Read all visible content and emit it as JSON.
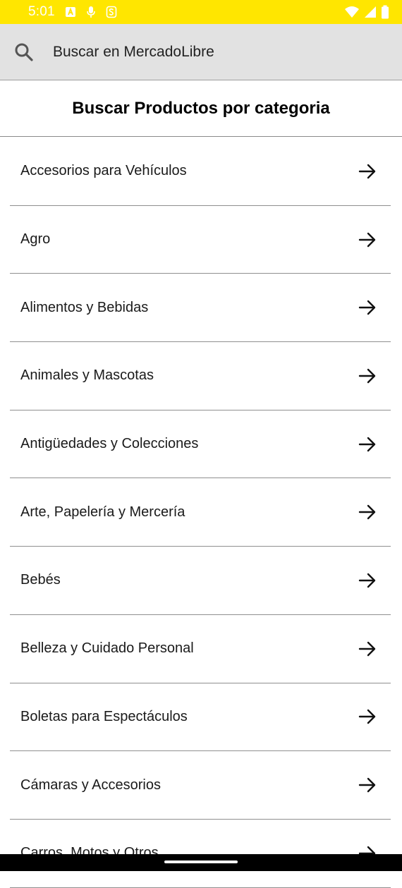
{
  "status_bar": {
    "time": "5:01",
    "background": "#ffe600",
    "left_icons": [
      "a-box-icon",
      "mic-icon",
      "s-icon"
    ],
    "right_icons": [
      "wifi-icon",
      "signal-icon",
      "battery-icon"
    ]
  },
  "search": {
    "placeholder": "Buscar en MercadoLibre"
  },
  "header": {
    "title": "Buscar Productos por categoria"
  },
  "categories": [
    {
      "label": "Accesorios para Vehículos"
    },
    {
      "label": "Agro"
    },
    {
      "label": "Alimentos y Bebidas"
    },
    {
      "label": "Animales y Mascotas"
    },
    {
      "label": "Antigüedades y Colecciones"
    },
    {
      "label": "Arte, Papelería y Mercería"
    },
    {
      "label": "Bebés"
    },
    {
      "label": "Belleza y Cuidado Personal"
    },
    {
      "label": "Boletas para Espectáculos"
    },
    {
      "label": "Cámaras y Accesorios"
    },
    {
      "label": "Carros, Motos y Otros"
    }
  ]
}
